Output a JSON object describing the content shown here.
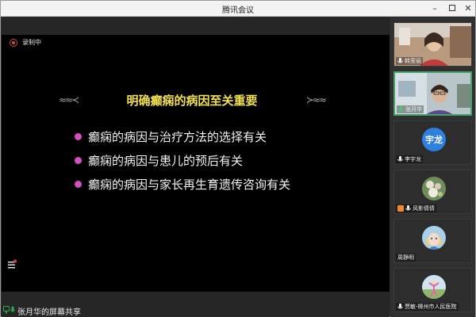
{
  "window": {
    "title": "腾讯会议"
  },
  "recording": {
    "label": "录制中"
  },
  "slide": {
    "title": "明确癫痫的病因至关重要",
    "bullets": [
      "癫痫的病因与治疗方法的选择有关",
      "癫痫的病因与患儿的预后有关",
      "癫痫的病因与家长再生育遗传咨询有关"
    ]
  },
  "share": {
    "label": "张月华的屏幕共享"
  },
  "participants": [
    {
      "name": "韩莹丽",
      "type": "video"
    },
    {
      "name": "张月华",
      "type": "video",
      "active": true
    },
    {
      "name": "李宇龙",
      "type": "avatar-text",
      "avatar_text": "宇龙"
    },
    {
      "name": "风影倩倩",
      "type": "avatar-image"
    },
    {
      "name": "周静明",
      "type": "avatar-image"
    },
    {
      "name": "贾敏-柳州市人民医院",
      "type": "avatar-image"
    }
  ],
  "colors": {
    "slide_title": "#f0e052",
    "bullet": "#d24fc4",
    "active_speaker_border": "#4aa06a",
    "avatar_blue": "#2d7fe0",
    "recording": "#c94a4a"
  },
  "icons": [
    "recording-icon",
    "minimize-icon",
    "maximize-icon",
    "close-icon",
    "mic-icon",
    "tools-icon",
    "screen-share-icon"
  ]
}
